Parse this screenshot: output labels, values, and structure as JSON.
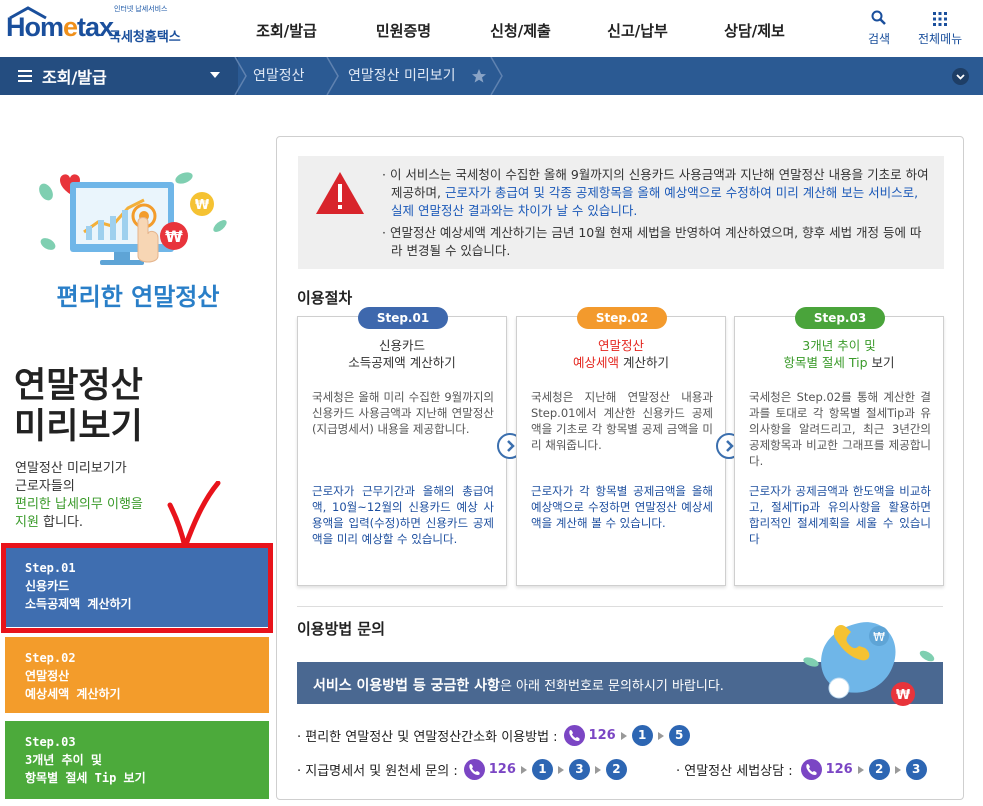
{
  "header": {
    "logo_tagline": "인터넷 납세서비스",
    "logo_word_a": "Hom",
    "logo_word_e": "e",
    "logo_word_b": "tax.",
    "logo_name": "국세청홈택스",
    "nav": [
      "조회/발급",
      "민원증명",
      "신청/제출",
      "신고/납부",
      "상담/제보"
    ],
    "search_label": "검색",
    "menu_label": "전체메뉴"
  },
  "location": {
    "menu_label": "조회/발급",
    "crumbs": [
      "연말정산",
      "연말정산 미리보기"
    ]
  },
  "left": {
    "hero_title": "편리한 연말정산",
    "big_title_1": "연말정산",
    "big_title_2": "미리보기",
    "desc_1": "연말정산 미리보기가",
    "desc_2": "근로자들의",
    "desc_3_hl": "편리한 납세의무 이행을",
    "desc_4_hl": "지원",
    "desc_4_rest": " 합니다.",
    "steps": [
      {
        "line1": "Step.01",
        "line2": "신용카드",
        "line3": "소득공제액 계산하기"
      },
      {
        "line1": "Step.02",
        "line2": "연말정산",
        "line3": "예상세액 계산하기"
      },
      {
        "line1": "Step.03",
        "line2": "3개년 추이 및",
        "line3": "항목별 절세 Tip 보기"
      }
    ]
  },
  "notice": {
    "p1_a": "이 서비스는 국세청이 수집한 올해 9월까지의 신용카드 사용금액과 지난해 연말정산 내용을 기초로 하여 제공하며, ",
    "p1_blue": "근로자가 총급여 및 각종 공제항목을 올해 예상액으로 수정하여 미리 계산해 보는 서비스로, 실제 연말정산 결과와는 차이가 날 수 있습니다.",
    "p2": "연말정산 예상세액 계산하기는 금년 10월 현재 세법을 반영하여 계산하였으며, 향후 세법 개정 등에 따라 변경될 수 있습니다."
  },
  "procedure": {
    "title": "이용절차",
    "cards": [
      {
        "pill": "Step.01",
        "pill_color": "#3e68ad",
        "head_1": "신용카드",
        "head_1_color": "#333333",
        "head_2": "소득공제액 계산하기",
        "body": "국세청은 올해 미리 수집한 9월까지의 신용카드 사용금액과 지난해 연말정산(지급명세서) 내용을 제공합니다.",
        "blue": "근로자가 근무기간과 올해의 총급여액, 10월~12월의 신용카드 예상 사용액을 입력(수정)하면 신용카드 공제액을 미리 예상할 수 있습니다."
      },
      {
        "pill": "Step.02",
        "pill_color": "#f39a2d",
        "head_1": "연말정산",
        "head_1_color": "#e4271f",
        "head_2a": "예상세액",
        "head_2b": " 계산하기",
        "body": "국세청은 지난해 연말정산 내용과 Step.01에서 계산한 신용카드 공제액을 기초로 각 항목별 공제 금액을 미리 채워줍니다.",
        "blue": "근로자가 각 항목별 공제금액을 올해예상액으로 수정하면 연말정산 예상세액을 계산해 볼 수 있습니다."
      },
      {
        "pill": "Step.03",
        "pill_color": "#4aa43b",
        "head_1": "3개년 추이 및",
        "head_1_color": "#3a9a2a",
        "head_2a": "항목별 절세 Tip",
        "head_2b": " 보기",
        "body": "국세청은 Step.02를 통해 계산한 결과를 토대로 각 항목별 절세Tip과 유의사항을 알려드리고, 최근 3년간의 공제항목과 비교한 그래프를 제공합니다.",
        "blue": "근로자가 공제금액과 한도액을 비교하고, 절세Tip과 유의사항을 활용하면 합리적인 절세계획을 세울 수 있습니다"
      }
    ]
  },
  "inquiry": {
    "title": "이용방법 문의",
    "banner_bold": "서비스 이용방법 등 궁금한 사항",
    "banner_rest": "은 아래 전화번호로 문의하시기 바랍니다.",
    "line1_label": "· 편리한 연말정산 및 연말정산간소화 이용방법 :",
    "line1_num": "126",
    "line1_seq": [
      "1",
      "5"
    ],
    "line2_label": "· 지급명세서 및 원천세 문의 :",
    "line2_num": "126",
    "line2_seq": [
      "1",
      "3",
      "2"
    ],
    "line3_label": "· 연말정산 세법상담 :",
    "line3_num": "126",
    "line3_seq": [
      "2",
      "3"
    ]
  }
}
